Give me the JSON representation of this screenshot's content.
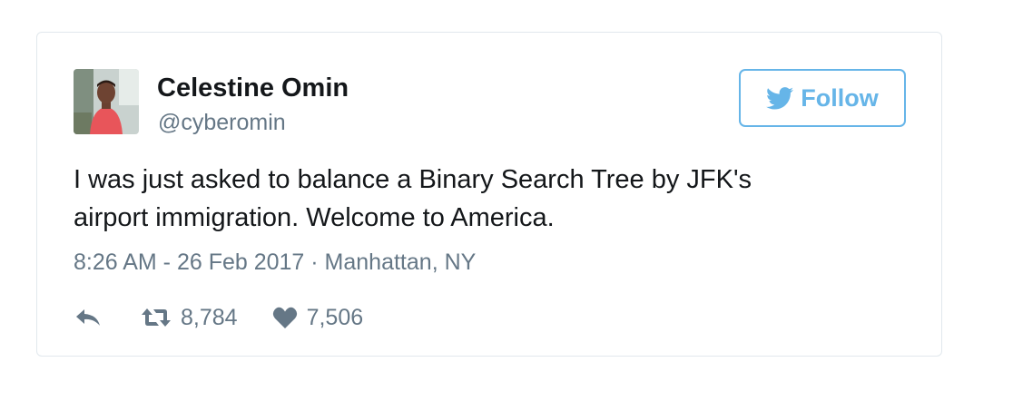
{
  "tweet": {
    "author": {
      "display_name": "Celestine Omin",
      "handle": "@cyberomin",
      "avatar_icon": "user-avatar-photo"
    },
    "follow_button": {
      "label": "Follow",
      "icon": "twitter-bird-icon",
      "color": "#66b5e8"
    },
    "text_lines": [
      "I was just asked to balance a Binary Search Tree by JFK's",
      "airport immigration. Welcome to America."
    ],
    "meta": "8:26 AM - 26 Feb 2017 · Manhattan, NY",
    "actions": {
      "reply_icon": "reply-icon",
      "retweet_icon": "retweet-icon",
      "retweet_count": "8,784",
      "like_icon": "heart-icon",
      "like_count": "7,506"
    },
    "colors": {
      "text": "#14171a",
      "secondary": "#657786",
      "border": "#e1e8ed"
    }
  }
}
